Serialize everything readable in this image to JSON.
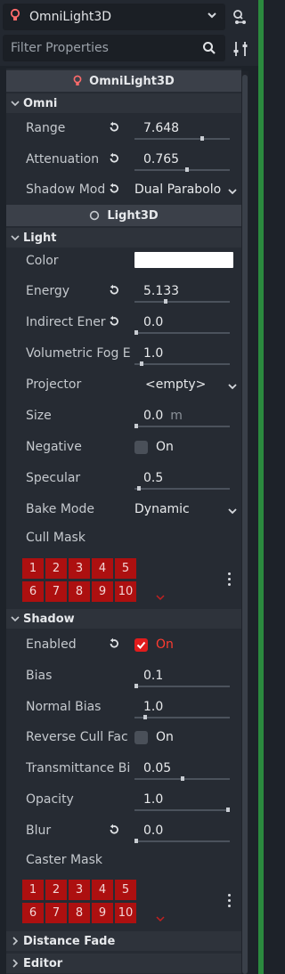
{
  "colors": {
    "accent_red": "#e01c1c",
    "cell_red": "#ad1010",
    "panel_bg": "#262b33",
    "green_bar": "#2b8a3e"
  },
  "top": {
    "node_name": "OmniLight3D",
    "node_icon": "light-bulb-icon",
    "filter_placeholder": "Filter Properties"
  },
  "class_headers": {
    "omni": "OmniLight3D",
    "light": "Light3D"
  },
  "sections": {
    "omni": "Omni",
    "light": "Light",
    "shadow": "Shadow",
    "distance_fade": "Distance Fade",
    "editor": "Editor"
  },
  "omni": {
    "range": {
      "label": "Range",
      "value": "7.648",
      "slider": 0.72
    },
    "attenuation": {
      "label": "Attenuation",
      "value": "0.765",
      "slider": 0.55
    },
    "shadow_mode": {
      "label": "Shadow Mod",
      "value": "Dual Parabolo"
    }
  },
  "light": {
    "color": {
      "label": "Color",
      "value_hex": "#ffffff"
    },
    "energy": {
      "label": "Energy",
      "value": "5.133",
      "slider": 0.32
    },
    "indirect": {
      "label": "Indirect Ener",
      "value": "0.0",
      "slider": 0.0
    },
    "volumetric": {
      "label": "Volumetric Fog E",
      "value": "1.0",
      "slider": 0.06
    },
    "projector": {
      "label": "Projector",
      "value": "<empty>"
    },
    "size": {
      "label": "Size",
      "value": "0.0",
      "unit": "m",
      "slider": 0.0
    },
    "negative": {
      "label": "Negative",
      "value": "On",
      "checked": false
    },
    "specular": {
      "label": "Specular",
      "value": "0.5",
      "slider": 0.03
    },
    "bake_mode": {
      "label": "Bake Mode",
      "value": "Dynamic"
    },
    "cull_mask": {
      "label": "Cull Mask",
      "cells": [
        "1",
        "2",
        "3",
        "4",
        "5",
        "6",
        "7",
        "8",
        "9",
        "10"
      ]
    }
  },
  "shadow": {
    "enabled": {
      "label": "Enabled",
      "value": "On",
      "checked": true
    },
    "bias": {
      "label": "Bias",
      "value": "0.1",
      "slider": 0.0
    },
    "normal_bias": {
      "label": "Normal Bias",
      "value": "1.0",
      "slider": 0.1
    },
    "reverse_cull": {
      "label": "Reverse Cull Fac",
      "value": "On",
      "checked": false
    },
    "transmittance": {
      "label": "Transmittance Bi",
      "value": "0.05",
      "slider": 0.5
    },
    "opacity": {
      "label": "Opacity",
      "value": "1.0",
      "slider": 1.0
    },
    "blur": {
      "label": "Blur",
      "value": "0.0",
      "slider": 0.0
    },
    "caster_mask": {
      "label": "Caster Mask",
      "cells": [
        "1",
        "2",
        "3",
        "4",
        "5",
        "6",
        "7",
        "8",
        "9",
        "10"
      ]
    }
  }
}
